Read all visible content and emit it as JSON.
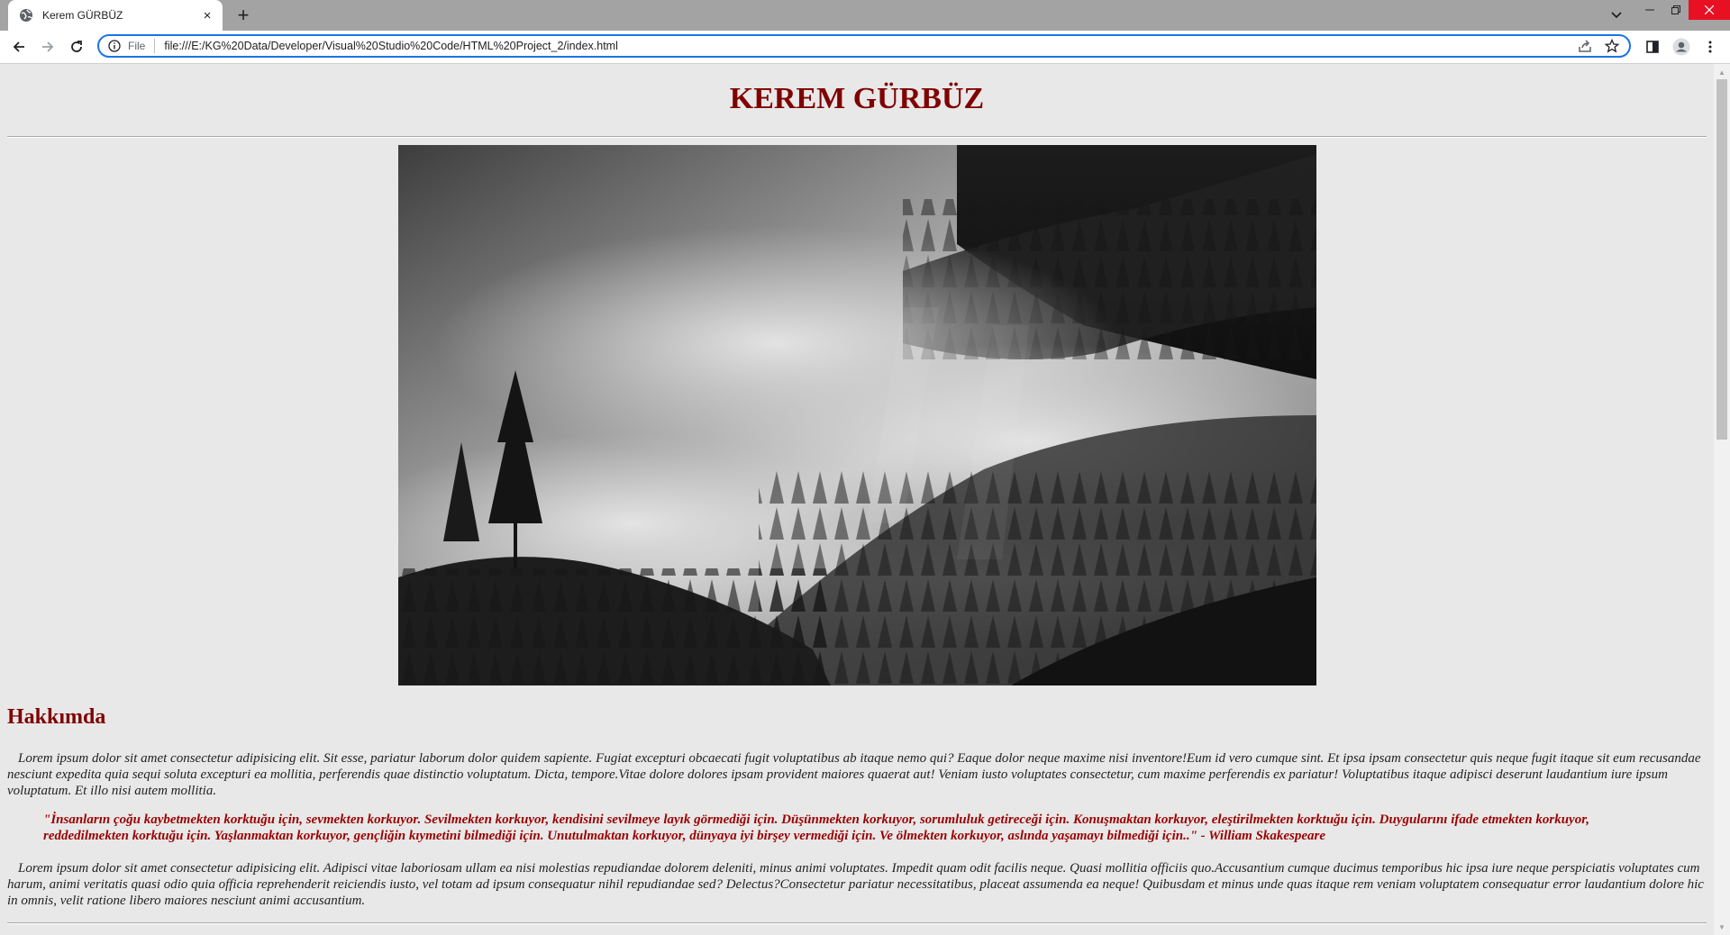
{
  "browser": {
    "tab_title": "Kerem GÜRBÜZ",
    "tab_close": "×",
    "new_tab": "+",
    "scheme_label": "File",
    "url": "file:///E:/KG%20Data/Developer/Visual%20Studio%20Code/HTML%20Project_2/index.html"
  },
  "page": {
    "title": "KEREM GÜRBÜZ",
    "about_heading": "Hakkımda",
    "paragraph_1": "Lorem ipsum dolor sit amet consectetur adipisicing elit. Sit esse, pariatur laborum dolor quidem sapiente. Fugiat excepturi obcaecati fugit voluptatibus ab itaque nemo qui? Eaque dolor neque maxime nisi inventore!Eum id vero cumque sint. Et ipsa ipsam consectetur quis neque fugit itaque sit eum recusandae nesciunt expedita quia sequi soluta excepturi ea mollitia, perferendis quae distinctio voluptatum. Dicta, tempore.Vitae dolore dolores ipsam provident maiores quaerat aut! Veniam iusto voluptates consectetur, cum maxime perferendis ex pariatur! Voluptatibus itaque adipisci deserunt laudantium iure ipsum voluptatum. Et illo nisi autem mollitia.",
    "quote": "\"İnsanların çoğu kaybetmekten korktuğu için, sevmekten korkuyor. Sevilmekten korkuyor, kendisini sevilmeye layık görmediği için. Düşünmekten korkuyor, sorumluluk getireceği için. Konuşmaktan korkuyor, eleştirilmekten korktuğu için. Duygularını ifade etmekten korkuyor, reddedilmekten korktuğu için. Yaşlanmaktan korkuyor, gençliğin kıymetini bilmediği için. Unutulmaktan korkuyor, dünyaya iyi birşey vermediği için. Ve ölmekten korkuyor, aslında yaşamayı bilmediği için..\" - William Skakespeare",
    "paragraph_2": "Lorem ipsum dolor sit amet consectetur adipisicing elit. Adipisci vitae laboriosam ullam ea nisi molestias repudiandae dolorem deleniti, minus animi voluptates. Impedit quam odit facilis neque. Quasi mollitia officiis quo.Accusantium cumque ducimus temporibus hic ipsa iure neque perspiciatis voluptates cum harum, animi veritatis quasi odio quia officia reprehenderit reiciendis iusto, vel totam ad ipsum consequatur nihil repudiandae sed? Delectus?Consectetur pariatur necessitatibus, placeat assumenda ea neque! Quibusdam et minus unde quas itaque rem veniam voluptatem consequatur error laudantium dolore hic in omnis, velit ratione libero maiores nesciunt animi accusantium."
  },
  "colors": {
    "heading": "#800000",
    "quote": "#9b0000",
    "page_bg": "#e8e8e8",
    "accent": "#1a73e8"
  },
  "icons": {
    "favicon": "globe-icon",
    "back": "back-arrow-icon",
    "forward": "forward-arrow-icon",
    "reload": "reload-icon",
    "site_info": "info-icon",
    "share": "share-icon",
    "bookmark": "star-icon",
    "side_panel": "side-panel-icon",
    "profile": "profile-icon",
    "menu": "kebab-menu-icon",
    "hero_image": "misty-forest-photo"
  }
}
